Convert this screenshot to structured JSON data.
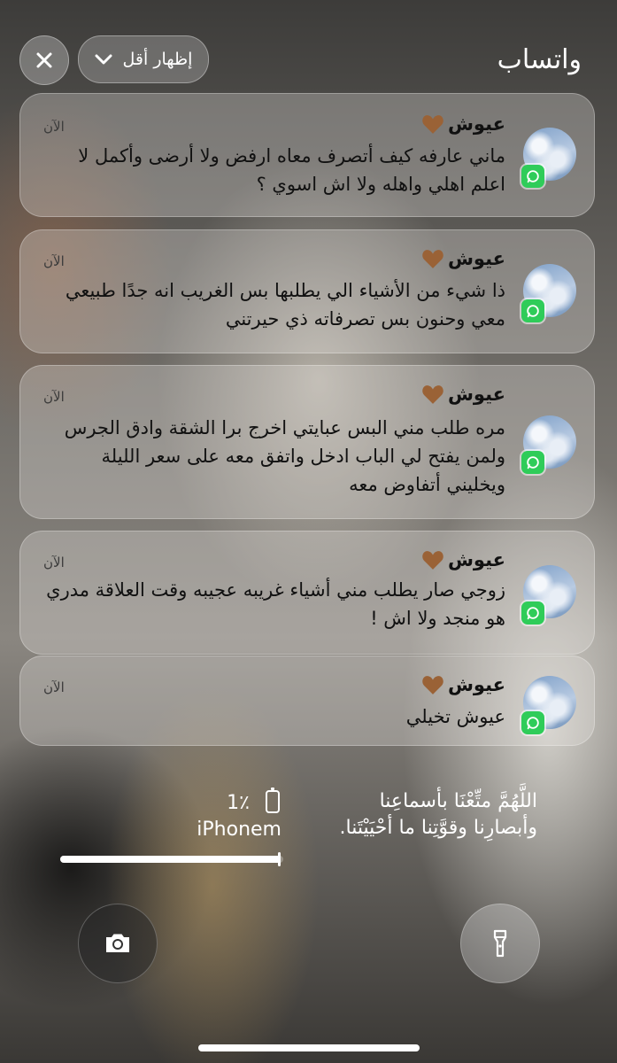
{
  "header": {
    "app_title": "واتساب",
    "show_less_label": "إظهار أقل"
  },
  "notifications": [
    {
      "sender": "عيوش",
      "time": "الآن",
      "body": "ماني عارفه كيف أتصرف معاه ارفض ولا أرضى وأكمل لا اعلم اهلي واهله ولا اش اسوي ؟"
    },
    {
      "sender": "عيوش",
      "time": "الآن",
      "body": "ذا شيء من الأشياء الي يطلبها بس الغريب انه جدًا طبيعي معي وحنون بس تصرفاته ذي حيرتني"
    },
    {
      "sender": "عيوش",
      "time": "الآن",
      "body": "مره طلب مني البس عبايتي اخرج برا الشقة وادق الجرس ولمن يفتح لي الباب ادخل واتفق معه على سعر الليلة ويخليني أتفاوض معه"
    },
    {
      "sender": "عيوش",
      "time": "الآن",
      "body": "زوجي صار يطلب مني أشياء غريبه عجيبه وقت العلاقة مدري هو منجد ولا اش !"
    },
    {
      "sender": "عيوش",
      "time": "الآن",
      "body": "عيوش تخيلي"
    }
  ],
  "lockscreen": {
    "dua_text": "اللَّهُمَّ متِّعْنَا بأسماعِنا وأبصارِنا وقوَّتِنا ما أحْيَيْتَنا.",
    "battery_percent": "1٪",
    "battery_level": 0.01,
    "device_name": "iPhonem",
    "media_progress": 0.985
  },
  "colors": {
    "whatsapp_green": "#2fcc59",
    "heart_brown": "#9a6236"
  },
  "icons": {
    "close": "close-icon",
    "chevron": "chevron-down-icon",
    "camera": "camera-icon",
    "flashlight": "flashlight-icon",
    "whatsapp": "whatsapp-icon",
    "heart": "brown-heart-icon",
    "battery": "battery-icon"
  }
}
